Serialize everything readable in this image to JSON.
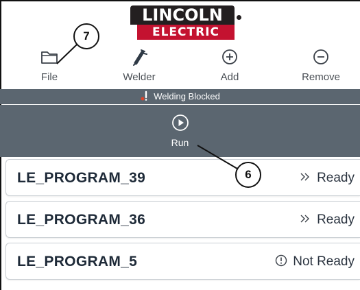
{
  "header": {
    "logo_top": "LINCOLN",
    "logo_bottom": "ELECTRIC",
    "logo_colors": {
      "top": "#231f20",
      "bottom": "#c41230"
    }
  },
  "toolbar": {
    "items": [
      {
        "label": "File",
        "icon": "folder-icon"
      },
      {
        "label": "Welder",
        "icon": "welder-torch-icon"
      },
      {
        "label": "Add",
        "icon": "plus-circle-icon"
      },
      {
        "label": "Remove",
        "icon": "minus-circle-icon"
      }
    ]
  },
  "status": {
    "text": "Welding Blocked",
    "icon": "welding-blocked-icon",
    "background": "#5b6670"
  },
  "run": {
    "label": "Run",
    "icon": "play-circle-icon"
  },
  "programs": [
    {
      "name": "LE_PROGRAM_39",
      "state": "Ready",
      "state_icon": "double-chevron-right-icon"
    },
    {
      "name": "LE_PROGRAM_36",
      "state": "Ready",
      "state_icon": "double-chevron-right-icon"
    },
    {
      "name": "LE_PROGRAM_5",
      "state": "Not Ready",
      "state_icon": "exclamation-circle-icon"
    }
  ],
  "callouts": [
    {
      "number": "7"
    },
    {
      "number": "6"
    }
  ]
}
